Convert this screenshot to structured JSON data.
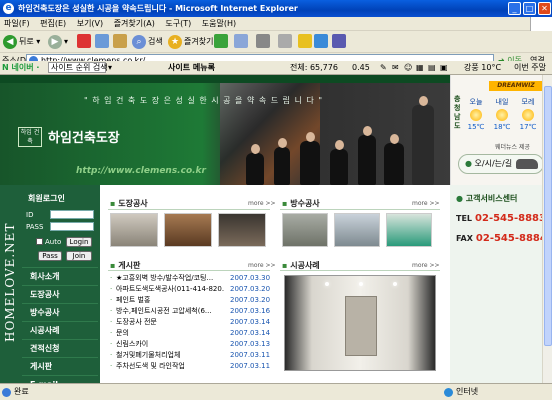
{
  "window": {
    "title": "하임건축도장은 성실한 시공을 약속드립니다 - Microsoft Internet Explorer",
    "min": "_",
    "max": "□",
    "close": "✕"
  },
  "menu": [
    "파일(F)",
    "편집(E)",
    "보기(V)",
    "즐겨찾기(A)",
    "도구(T)",
    "도움말(H)"
  ],
  "toolbar": {
    "back": "뒤로",
    "search": "검색",
    "favorites": "즐겨찾기"
  },
  "address": {
    "label": "주소(D)",
    "url": "http://www.clemens.co.kr/",
    "go": "이동",
    "links": "연결"
  },
  "naverbar": {
    "brand": "N 네이버 ·",
    "search_placeholder": "사이트 순위 검색",
    "site_label": "사이트 메뉴록",
    "total": "전체: 65,776",
    "score": "0.45",
    "weather": "강풍 10°C",
    "prev": "이번 주말"
  },
  "banner": {
    "slogan": "\" 하 임 건 축 도 장 은   성 실 한   시 공 을   약 속 드 립 니 다 \"",
    "logo": "하임 건축",
    "name": "하임건축도장",
    "url": "http://www.clemens.co.kr"
  },
  "weather": {
    "brand": "DREAMWIZ",
    "region": "충청남도",
    "days": [
      {
        "label": "오늘",
        "temp": "15℃"
      },
      {
        "label": "내일",
        "temp": "18℃"
      },
      {
        "label": "모레",
        "temp": "17℃"
      }
    ],
    "source": "웨더뉴스 제공"
  },
  "directions": "오/시/는/길",
  "service": {
    "title": "고객서비스센터",
    "tel_label": "TEL",
    "tel": "02-545-8883",
    "fax_label": "FAX",
    "fax": "02-545-8884"
  },
  "leftnav": {
    "vertical": "HOMELOVE.NET",
    "login_title": "회원로그인",
    "id_label": "ID",
    "pass_label": "PASS",
    "auto": "Auto",
    "login": "Login",
    "pass_btn": "Pass",
    "join": "Join",
    "items": [
      "회사소개",
      "도장공사",
      "방수공사",
      "시공사례",
      "견적신청",
      "게시판",
      "E-mail"
    ]
  },
  "sections": {
    "painting": {
      "title": "도장공사",
      "more": "more >>"
    },
    "waterproof": {
      "title": "방수공사",
      "more": "more >>"
    },
    "board": {
      "title": "게시판",
      "more": "more >>"
    },
    "cases": {
      "title": "시공사례",
      "more": "more >>"
    }
  },
  "board": [
    {
      "title": "★고흥외벽 방수/발수작업/코팅...",
      "date": "2007.03.30"
    },
    {
      "title": "아파트도색도색공사(011-414-820...",
      "date": "2007.03.20"
    },
    {
      "title": "페인트 벌홍",
      "date": "2007.03.20"
    },
    {
      "title": "방수,페인트시공전 고압세척(6...",
      "date": "2007.03.16"
    },
    {
      "title": "도장공사 전문",
      "date": "2007.03.14"
    },
    {
      "title": "문의",
      "date": "2007.03.14"
    },
    {
      "title": "신림스카이",
      "date": "2007.03.13"
    },
    {
      "title": "철거및폐기물처리업체",
      "date": "2007.03.11"
    },
    {
      "title": "주차선도색 및 라인작업",
      "date": "2007.03.11"
    }
  ],
  "status": {
    "text": "완료",
    "zone": "인터넷"
  }
}
